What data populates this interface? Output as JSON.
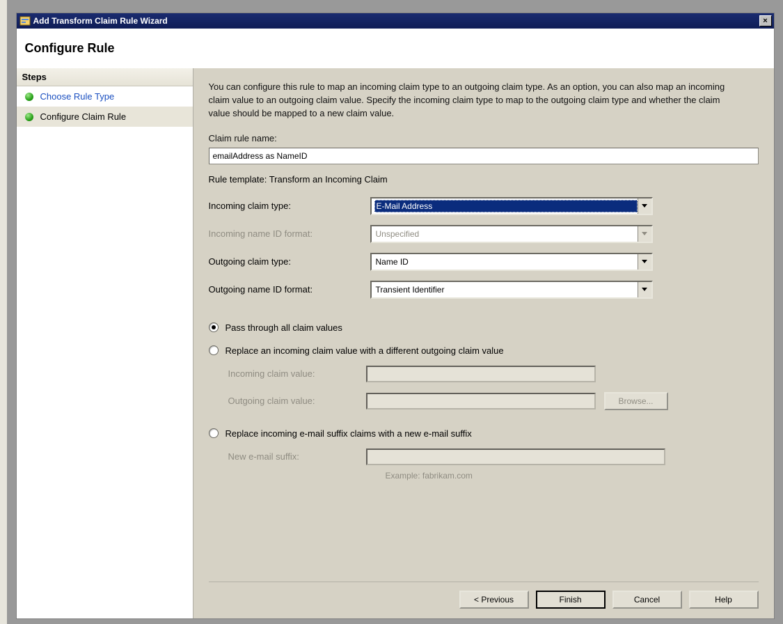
{
  "window": {
    "title": "Add Transform Claim Rule Wizard",
    "close_glyph": "×"
  },
  "header": {
    "title": "Configure Rule"
  },
  "sidebar": {
    "header": "Steps",
    "items": [
      {
        "label": "Choose Rule Type"
      },
      {
        "label": "Configure Claim Rule"
      }
    ]
  },
  "main": {
    "description": "You can configure this rule to map an incoming claim type to an outgoing claim type. As an option, you can also map an incoming claim value to an outgoing claim value. Specify the incoming claim type to map to the outgoing claim type and whether the claim value should be mapped to a new claim value.",
    "claim_rule_name_label": "Claim rule name:",
    "claim_rule_name_value": "emailAddress as NameID",
    "rule_template_label": "Rule template: Transform an Incoming Claim",
    "fields": {
      "incoming_type_label": "Incoming claim type:",
      "incoming_type_value": "E-Mail Address",
      "incoming_nameid_label": "Incoming name ID format:",
      "incoming_nameid_value": "Unspecified",
      "outgoing_type_label": "Outgoing claim type:",
      "outgoing_type_value": "Name ID",
      "outgoing_nameid_label": "Outgoing name ID format:",
      "outgoing_nameid_value": "Transient Identifier"
    },
    "radios": {
      "pass_through": "Pass through all claim values",
      "replace_value": "Replace an incoming claim value with a different outgoing claim value",
      "replace_suffix": "Replace incoming e-mail suffix claims with a new e-mail suffix"
    },
    "sub_labels": {
      "incoming_value": "Incoming claim value:",
      "outgoing_value": "Outgoing claim value:",
      "new_suffix": "New e-mail suffix:",
      "example": "Example: fabrikam.com"
    },
    "buttons": {
      "browse": "Browse...",
      "previous": "< Previous",
      "finish": "Finish",
      "cancel": "Cancel",
      "help": "Help"
    }
  }
}
